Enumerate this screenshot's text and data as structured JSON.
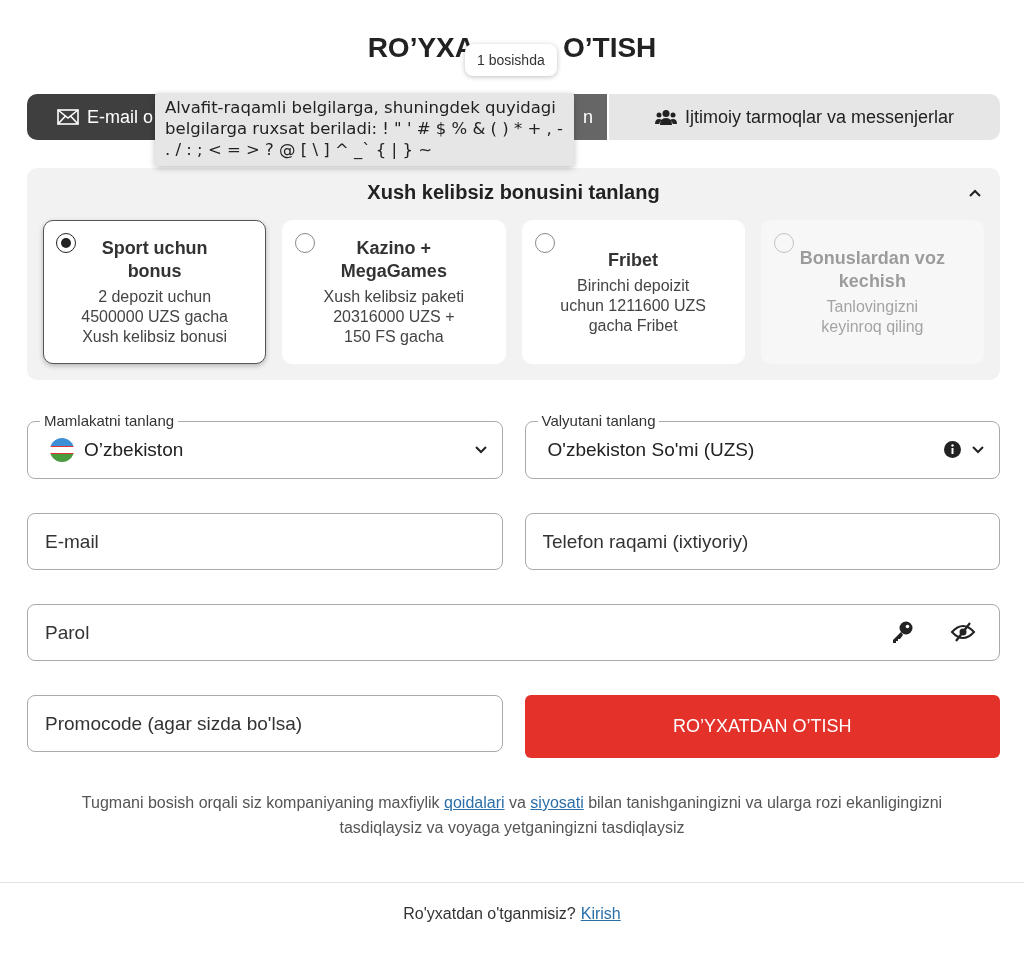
{
  "title": {
    "start": "RO’YXA",
    "end": "O’TISH"
  },
  "title_tooltip": "1 bosishda",
  "tabs": [
    {
      "label": "E-mail o",
      "selected": true,
      "hovered": false
    },
    {
      "label": "n",
      "selected": false,
      "hovered": true
    },
    {
      "label": "Ijtimoiy tarmoqlar va messenjerlar",
      "selected": false,
      "hovered": false
    }
  ],
  "tooltip": "Alvafit-raqamli belgilarga, shuningdek quyidagi belgilarga ruxsat beriladi: ! \" ' # $ % & ( ) * + , - . / : ; < = > ? @ [ \\ ] ^ _` { | } ~",
  "bonus": {
    "heading": "Xush kelibsiz bonusini tanlang",
    "expanded": true,
    "options": [
      {
        "title": "Sport uchun bonus",
        "description": "2 depozit uchun 4500000 UZS gacha Xush kelibsiz bonusi",
        "selected": true,
        "disabled": false
      },
      {
        "title": "Kazino + MegaGames",
        "description": "Xush kelibsiz paketi 20316000 UZS + 150 FS gacha",
        "selected": false,
        "disabled": false
      },
      {
        "title": "Fribet",
        "description": "Birinchi depoizit uchun 1211600 UZS gacha Fribet",
        "selected": false,
        "disabled": false
      },
      {
        "title": "Bonuslardan voz kechish",
        "description": "Tanlovingizni keyinroq qiling",
        "selected": false,
        "disabled": true
      }
    ]
  },
  "country": {
    "label": "Mamlakatni tanlang",
    "value": "O’zbekiston"
  },
  "currency": {
    "label": "Valyutani tanlang",
    "value": "O'zbekiston So'mi (UZS)"
  },
  "email": {
    "placeholder": "E-mail"
  },
  "phone": {
    "placeholder": "Telefon raqami (ixtiyoriy)"
  },
  "password": {
    "placeholder": "Parol"
  },
  "promocode": {
    "placeholder": "Promocode (agar sizda bo'lsa)"
  },
  "submit": "RO’YXATDAN O’TISH",
  "consent": [
    {
      "kind": "text",
      "text": "Tugmani bosish orqali siz kompaniyaning maxfiylik "
    },
    {
      "kind": "link",
      "text": "qoidalari"
    },
    {
      "kind": "text",
      "text": " va "
    },
    {
      "kind": "link",
      "text": "siyosati"
    },
    {
      "kind": "text",
      "text": " bilan tanishganingizni va ularga rozi ekanligingizni tasdiqlaysiz va voyaga yetganingizni tasdiqlaysiz"
    }
  ],
  "login": {
    "question": "Ro'yxatdan o'tganmisiz?",
    "link": "Kirish"
  }
}
